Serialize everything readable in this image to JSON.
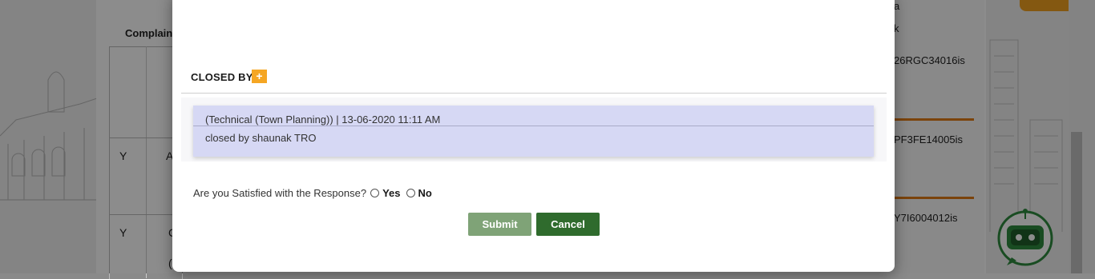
{
  "background": {
    "tab_label": "Complain",
    "table_cells": [
      "Y",
      "A",
      "Y",
      "C",
      "("
    ],
    "right_column": [
      "a",
      "k",
      "26RGC34016is",
      "PF3FE14005is",
      "Y7I6004012is"
    ]
  },
  "modal": {
    "section_title": "CLOSED BY",
    "add_icon": "+",
    "response": {
      "meta": "(Technical (Town Planning)) | 13-06-2020 11:11 AM",
      "text": "closed by shaunak TRO"
    },
    "satisfaction": {
      "question": "Are you Satisfied with the Response?",
      "yes_label": "Yes",
      "no_label": "No"
    },
    "buttons": {
      "submit": "Submit",
      "cancel": "Cancel"
    }
  },
  "colors": {
    "submit": "#7fa377",
    "cancel": "#2f6b2d",
    "badge": "#f5a623",
    "response_card": "#d6d8f4"
  },
  "icons": [
    "plus-icon",
    "chatbot-icon"
  ]
}
